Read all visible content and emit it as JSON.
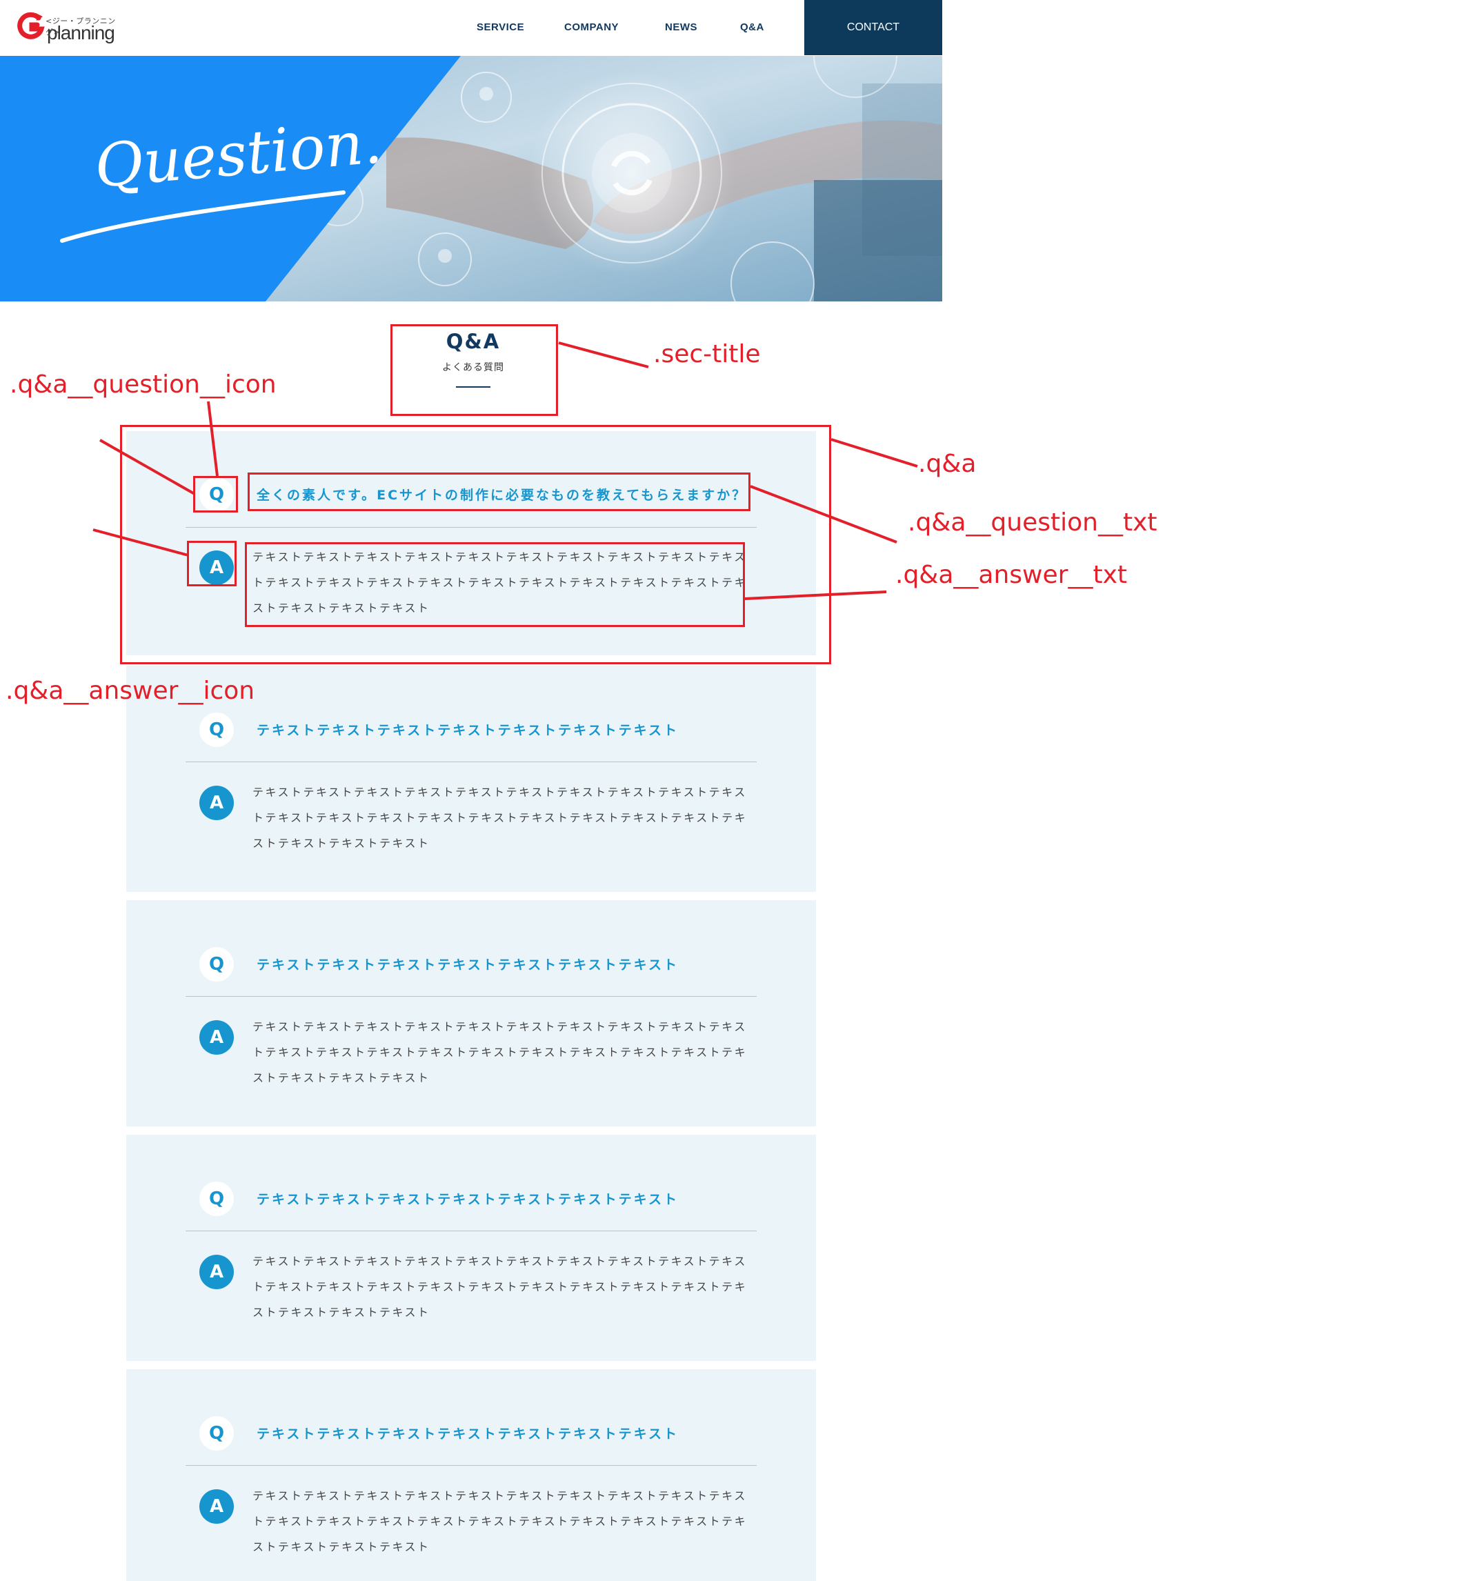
{
  "header": {
    "logo_kana": "<ジー・プランニング>",
    "logo_word": "planning",
    "nav": [
      "SERVICE",
      "COMPANY",
      "NEWS",
      "Q&A"
    ],
    "contact": "CONTACT"
  },
  "hero": {
    "script_title": "Question."
  },
  "section": {
    "title_en": "Q&A",
    "title_ja": "よくある質問"
  },
  "qa": [
    {
      "q_icon": "Q",
      "question": "全くの素人です。ECサイトの制作に必要なものを教えてもらえますか？",
      "a_icon": "A",
      "answer": "テキストテキストテキストテキストテキストテキストテキストテキストテキストテキストテキストテキストテキストテキストテキストテキストテキストテキストテキストテキストテキストテキストテキスト"
    },
    {
      "q_icon": "Q",
      "question": "テキストテキストテキストテキストテキストテキストテキスト",
      "a_icon": "A",
      "answer": "テキストテキストテキストテキストテキストテキストテキストテキストテキストテキストテキストテキストテキストテキストテキストテキストテキストテキストテキストテキストテキストテキストテキスト"
    },
    {
      "q_icon": "Q",
      "question": "テキストテキストテキストテキストテキストテキストテキスト",
      "a_icon": "A",
      "answer": "テキストテキストテキストテキストテキストテキストテキストテキストテキストテキストテキストテキストテキストテキストテキストテキストテキストテキストテキストテキストテキストテキストテキスト"
    },
    {
      "q_icon": "Q",
      "question": "テキストテキストテキストテキストテキストテキストテキスト",
      "a_icon": "A",
      "answer": "テキストテキストテキストテキストテキストテキストテキストテキストテキストテキストテキストテキストテキストテキストテキストテキストテキストテキストテキストテキストテキストテキストテキスト"
    },
    {
      "q_icon": "Q",
      "question": "テキストテキストテキストテキストテキストテキストテキスト",
      "a_icon": "A",
      "answer": "テキストテキストテキストテキストテキストテキストテキストテキストテキストテキストテキストテキストテキストテキストテキストテキストテキストテキストテキストテキストテキストテキストテキスト"
    }
  ],
  "annotations": {
    "sec_title": ".sec-title",
    "question_icon": ".q&a__question__icon",
    "qa": ".q&a",
    "question_txt": ".q&a__question__txt",
    "answer_txt": ".q&a__answer__txt",
    "answer_icon": ".q&a__answer__icon"
  },
  "colors": {
    "annotation": "#e3202a",
    "accent_blue": "#1795cf",
    "navy": "#0d3a5b",
    "card_bg": "#ebf4f8",
    "hero_blue": "#1a8cf5"
  }
}
